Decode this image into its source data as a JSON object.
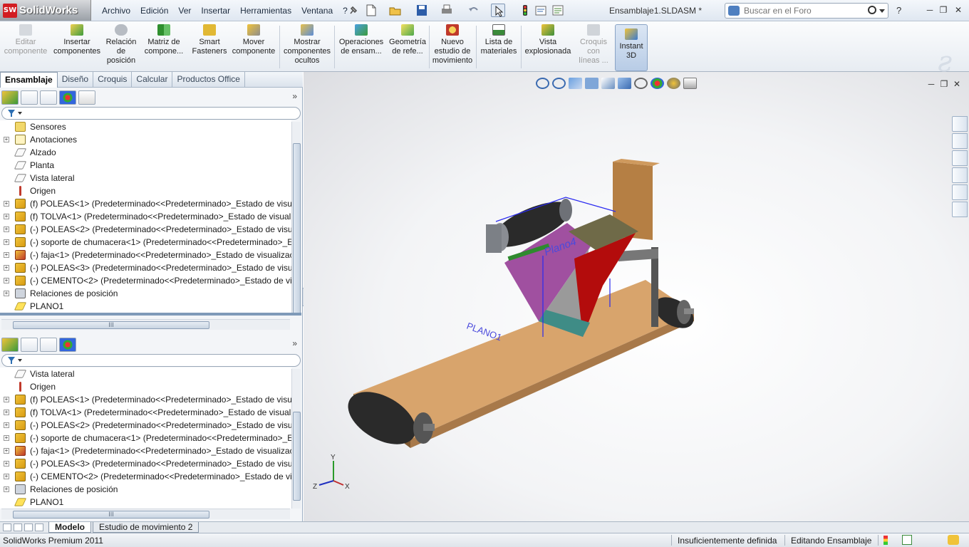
{
  "app": {
    "name": "SolidWorks",
    "logo_letters": "SW",
    "document_title": "Ensamblaje1.SLDASM *",
    "menu": [
      "Archivo",
      "Edición",
      "Ver",
      "Insertar",
      "Herramientas",
      "Ventana",
      "?"
    ],
    "search_placeholder": "Buscar en el Foro",
    "help": "?"
  },
  "commands": [
    {
      "label": "Editar componente",
      "icon": "edit-component-icon",
      "enabled": false
    },
    {
      "label": "Insertar componentes",
      "icon": "insert-components-icon",
      "enabled": true
    },
    {
      "label": "Relación de posición",
      "icon": "mate-icon",
      "enabled": true
    },
    {
      "label": "Matriz de compone...",
      "icon": "pattern-icon",
      "enabled": true
    },
    {
      "label": "Smart Fasteners",
      "icon": "smart-fasteners-icon",
      "enabled": true
    },
    {
      "label": "Mover componente",
      "icon": "move-component-icon",
      "enabled": true
    },
    {
      "label": "Mostrar componentes ocultos",
      "icon": "show-hidden-icon",
      "enabled": true
    },
    {
      "label": "Operaciones de ensam...",
      "icon": "assembly-features-icon",
      "enabled": true
    },
    {
      "label": "Geometría de refe...",
      "icon": "reference-geometry-icon",
      "enabled": true
    },
    {
      "label": "Nuevo estudio de movimiento",
      "icon": "motion-study-icon",
      "enabled": true
    },
    {
      "label": "Lista de materiales",
      "icon": "bom-icon",
      "enabled": true
    },
    {
      "label": "Vista explosionada",
      "icon": "exploded-view-icon",
      "enabled": true
    },
    {
      "label": "Croquis con líneas ...",
      "icon": "explode-line-sketch-icon",
      "enabled": false
    },
    {
      "label": "Instant 3D",
      "icon": "instant3d-icon",
      "enabled": true,
      "active": true
    }
  ],
  "tabs": [
    "Ensamblaje",
    "Diseño",
    "Croquis",
    "Calcular",
    "Productos Office"
  ],
  "active_tab": "Ensamblaje",
  "tree_top": [
    {
      "label": "Sensores",
      "icon": "sensor-icon",
      "expandable": false
    },
    {
      "label": "Anotaciones",
      "icon": "annotations-icon",
      "expandable": true
    },
    {
      "label": "Alzado",
      "icon": "plane-icon",
      "expandable": false
    },
    {
      "label": "Planta",
      "icon": "plane-icon",
      "expandable": false
    },
    {
      "label": "Vista lateral",
      "icon": "plane-icon",
      "expandable": false
    },
    {
      "label": "Origen",
      "icon": "origin-icon",
      "expandable": false
    },
    {
      "label": "(f) POLEAS<1> (Predeterminado<<Predeterminado>_Estado de visua",
      "icon": "part-icon",
      "expandable": true
    },
    {
      "label": "(f) TOLVA<1> (Predeterminado<<Predeterminado>_Estado de visuali",
      "icon": "part-icon",
      "expandable": true
    },
    {
      "label": "(-) POLEAS<2> (Predeterminado<<Predeterminado>_Estado de visua",
      "icon": "part-icon",
      "expandable": true
    },
    {
      "label": "(-) soporte de chumacera<1> (Predeterminado<<Predeterminado>_E",
      "icon": "part-icon",
      "expandable": true
    },
    {
      "label": "(-) faja<1> (Predeterminado<<Predeterminado>_Estado de visualizac",
      "icon": "part-red-icon",
      "expandable": true
    },
    {
      "label": "(-) POLEAS<3> (Predeterminado<<Predeterminado>_Estado de visua",
      "icon": "part-icon",
      "expandable": true
    },
    {
      "label": "(-) CEMENTO<2> (Predeterminado<<Predeterminado>_Estado de vis",
      "icon": "part-icon",
      "expandable": true
    },
    {
      "label": "Relaciones de posición",
      "icon": "mates-icon",
      "expandable": true
    },
    {
      "label": "PLANO1",
      "icon": "plane-yellow-icon",
      "expandable": false
    }
  ],
  "tree_bottom": [
    {
      "label": "Vista lateral",
      "icon": "plane-icon",
      "expandable": false
    },
    {
      "label": "Origen",
      "icon": "origin-icon",
      "expandable": false
    },
    {
      "label": "(f) POLEAS<1> (Predeterminado<<Predeterminado>_Estado de visua",
      "icon": "part-icon",
      "expandable": true
    },
    {
      "label": "(f) TOLVA<1> (Predeterminado<<Predeterminado>_Estado de visuali",
      "icon": "part-icon",
      "expandable": true
    },
    {
      "label": "(-) POLEAS<2> (Predeterminado<<Predeterminado>_Estado de visua",
      "icon": "part-icon",
      "expandable": true
    },
    {
      "label": "(-) soporte de chumacera<1> (Predeterminado<<Predeterminado>_E",
      "icon": "part-icon",
      "expandable": true
    },
    {
      "label": "(-) faja<1> (Predeterminado<<Predeterminado>_Estado de visualizac",
      "icon": "part-red-icon",
      "expandable": true
    },
    {
      "label": "(-) POLEAS<3> (Predeterminado<<Predeterminado>_Estado de visua",
      "icon": "part-icon",
      "expandable": true
    },
    {
      "label": "(-) CEMENTO<2> (Predeterminado<<Predeterminado>_Estado de vis",
      "icon": "part-icon",
      "expandable": true
    },
    {
      "label": "Relaciones de posición",
      "icon": "mates-icon",
      "expandable": true
    },
    {
      "label": "PLANO1",
      "icon": "plane-yellow-icon",
      "expandable": false
    }
  ],
  "scroll_grip": "III",
  "scene": {
    "plane_label_1": "Plano4",
    "plane_label_2": "PLANO1",
    "triad": {
      "x": "X",
      "y": "Y",
      "z": "Z"
    }
  },
  "bottom_tabs": [
    "Modelo",
    "Estudio de movimiento 2"
  ],
  "active_bottom_tab": "Modelo",
  "status": {
    "product": "SolidWorks Premium 2011",
    "definition": "Insuficientemente definida",
    "mode": "Editando Ensamblaje"
  },
  "colors": {
    "belt": "#d8a46c",
    "hopper_red": "#b30c0c",
    "hopper_purple": "#a050a0",
    "hopper_gray": "#9a9a9a",
    "hopper_teal": "#3f8c86",
    "box": "#b57f44",
    "roller": "#2a2a2a",
    "plane_label": "#4a4adc"
  }
}
